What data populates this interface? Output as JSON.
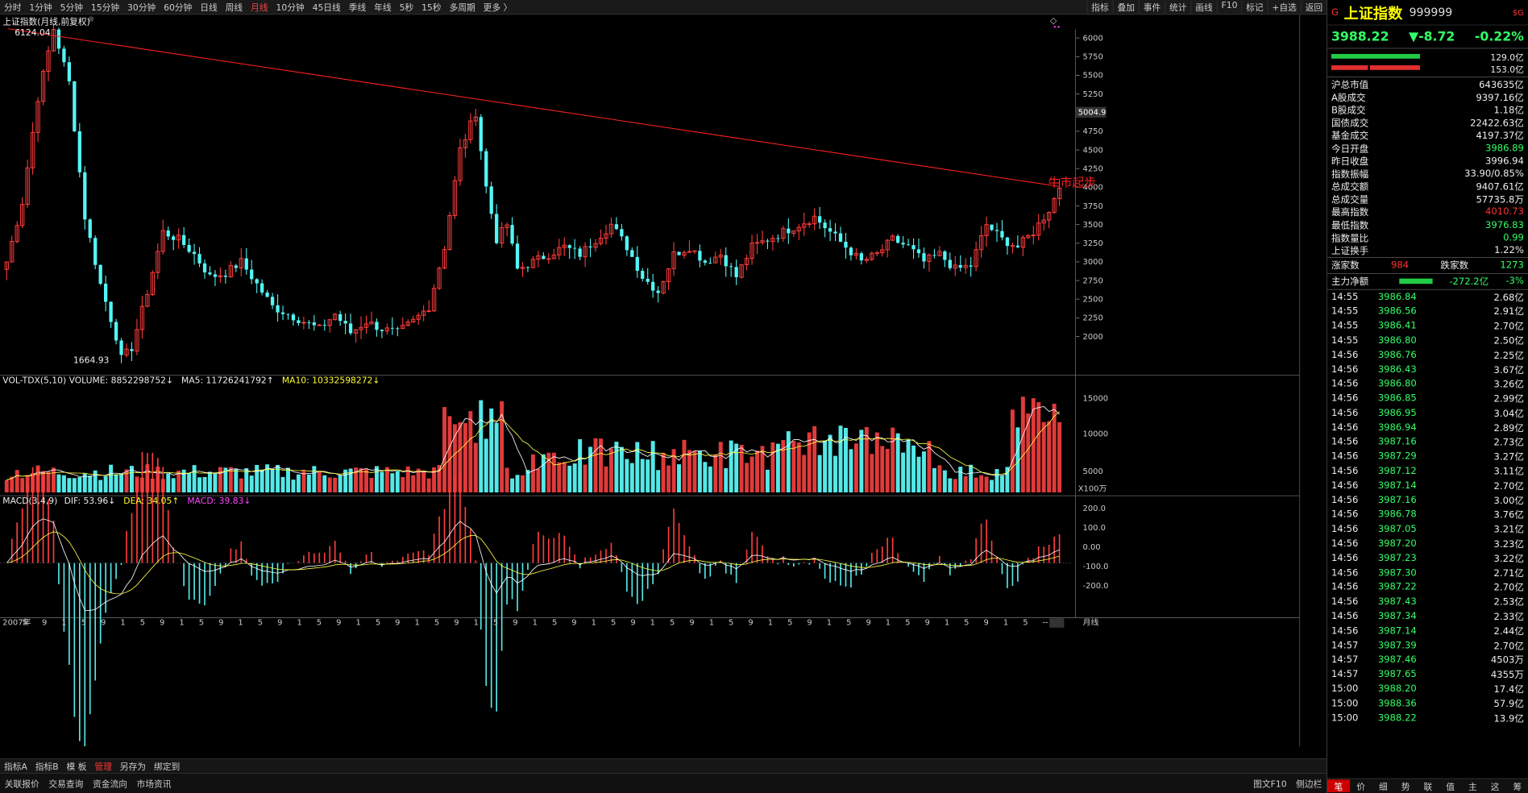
{
  "toolbar": {
    "items": [
      "分时",
      "1分钟",
      "5分钟",
      "15分钟",
      "30分钟",
      "60分钟",
      "日线",
      "周线",
      "月线",
      "10分钟",
      "45日线",
      "季线",
      "年线",
      "5秒",
      "15秒",
      "多周期",
      "更多 〉"
    ],
    "active": "月线",
    "right": [
      "指标",
      "叠加",
      "事件",
      "统计",
      "画线",
      "F10",
      "标记",
      "+自选",
      "返回"
    ]
  },
  "chart": {
    "title": "上证指数(月线,前复权)",
    "high_label": "6124.04",
    "low_label": "1664.93",
    "line_label": "牛市起步",
    "price_marker": "5004.9",
    "price_ticks": [
      "6000",
      "5750",
      "5500",
      "5250",
      "5000",
      "4750",
      "4500",
      "4250",
      "4000",
      "3750",
      "3500",
      "3250",
      "3000",
      "2750",
      "2500",
      "2250",
      "2000"
    ],
    "vol_label": "VOL-TDX(5,10) VOLUME: 8852298752↓",
    "vol_ma5": "MA5: 11726241792↑",
    "vol_ma10": "MA10: 10332598272↓",
    "vol_ticks": [
      "15000",
      "10000",
      "5000"
    ],
    "vol_unit": "X100万",
    "macd_label": "MACD(3,4,9)",
    "macd_dif": "DIF: 53.96↓",
    "macd_dea": "DEA: 34.05↑",
    "macd_val": "MACD: 39.83↓",
    "macd_ticks": [
      "200.0",
      "100.0",
      "0.00",
      "-100.0",
      "-200.0"
    ],
    "x_axis": [
      "2007年",
      "5",
      "9",
      "1",
      "5",
      "9",
      "1",
      "5",
      "9",
      "1",
      "5",
      "9",
      "1",
      "5",
      "9",
      "1",
      "5",
      "9",
      "1",
      "5",
      "9",
      "1",
      "5",
      "9",
      "1",
      "5",
      "9",
      "1",
      "5",
      "9",
      "1",
      "5",
      "9",
      "1",
      "5",
      "9",
      "1",
      "5",
      "9",
      "1",
      "5",
      "9",
      "1",
      "5",
      "9",
      "1",
      "5",
      "9",
      "1",
      "5",
      "9",
      "1",
      "5",
      "--"
    ],
    "period": "月线",
    "colors": {
      "up": "#ff3c3c",
      "down": "#54f5f5",
      "trend": "#ff2020"
    }
  },
  "tabs": {
    "items": [
      "指标A",
      "指标B",
      "模 板",
      "管理",
      "另存为",
      "绑定到"
    ],
    "selected": "管理"
  },
  "bottom": {
    "items": [
      "关联报价",
      "交易查询",
      "资金流向",
      "市场资讯"
    ],
    "right": [
      "图文F10",
      "侧边栏"
    ]
  },
  "side": {
    "flag": "G",
    "name": "上证指数",
    "code": "999999",
    "badge": "$G",
    "price": "3988.22",
    "change": "▼-8.72",
    "pct": "-0.22%",
    "bar1": "129.0亿",
    "bar2": "153.0亿",
    "stats": [
      [
        "沪总市值",
        "643635亿",
        "w"
      ],
      [
        "A股成交",
        "9397.16亿",
        "w"
      ],
      [
        "B股成交",
        "1.18亿",
        "w"
      ],
      [
        "国债成交",
        "22422.63亿",
        "w"
      ],
      [
        "基金成交",
        "4197.37亿",
        "w"
      ],
      [
        "今日开盘",
        "3986.89",
        "g"
      ],
      [
        "昨日收盘",
        "3996.94",
        "w"
      ],
      [
        "指数振幅",
        "33.90/0.85%",
        "w"
      ],
      [
        "总成交额",
        "9407.61亿",
        "w"
      ],
      [
        "总成交量",
        "57735.8万",
        "w"
      ],
      [
        "最高指数",
        "4010.73",
        "r"
      ],
      [
        "最低指数",
        "3976.83",
        "g"
      ],
      [
        "指数量比",
        "0.99",
        "g"
      ],
      [
        "上证换手",
        "1.22%",
        "w"
      ]
    ],
    "updown": {
      "up_label": "涨家数",
      "up": "984",
      "down_label": "跌家数",
      "down": "1273"
    },
    "flow": {
      "label": "主力净额",
      "value": "-272.2亿",
      "pct": "-3%"
    },
    "ticks": [
      [
        "14:55",
        "3986.84",
        "2.68亿"
      ],
      [
        "14:55",
        "3986.56",
        "2.91亿"
      ],
      [
        "14:55",
        "3986.41",
        "2.70亿"
      ],
      [
        "14:55",
        "3986.80",
        "2.50亿"
      ],
      [
        "14:56",
        "3986.76",
        "2.25亿"
      ],
      [
        "14:56",
        "3986.43",
        "3.67亿"
      ],
      [
        "14:56",
        "3986.80",
        "3.26亿"
      ],
      [
        "14:56",
        "3986.85",
        "2.99亿"
      ],
      [
        "14:56",
        "3986.95",
        "3.04亿"
      ],
      [
        "14:56",
        "3986.94",
        "2.89亿"
      ],
      [
        "14:56",
        "3987.16",
        "2.73亿"
      ],
      [
        "14:56",
        "3987.29",
        "3.27亿"
      ],
      [
        "14:56",
        "3987.12",
        "3.11亿"
      ],
      [
        "14:56",
        "3987.14",
        "2.70亿"
      ],
      [
        "14:56",
        "3987.16",
        "3.00亿"
      ],
      [
        "14:56",
        "3986.78",
        "3.76亿"
      ],
      [
        "14:56",
        "3987.05",
        "3.21亿"
      ],
      [
        "14:56",
        "3987.20",
        "3.23亿"
      ],
      [
        "14:56",
        "3987.23",
        "3.22亿"
      ],
      [
        "14:56",
        "3987.30",
        "2.71亿"
      ],
      [
        "14:56",
        "3987.22",
        "2.70亿"
      ],
      [
        "14:56",
        "3987.43",
        "2.53亿"
      ],
      [
        "14:56",
        "3987.34",
        "2.33亿"
      ],
      [
        "14:56",
        "3987.14",
        "2.44亿"
      ],
      [
        "14:57",
        "3987.39",
        "2.70亿"
      ],
      [
        "14:57",
        "3987.46",
        "4503万"
      ],
      [
        "14:57",
        "3987.65",
        "4355万"
      ],
      [
        "15:00",
        "3988.20",
        "17.4亿"
      ],
      [
        "15:00",
        "3988.36",
        "57.9亿"
      ],
      [
        "15:00",
        "3988.22",
        "13.9亿"
      ]
    ],
    "foot": [
      "笔",
      "价",
      "细",
      "势",
      "联",
      "值",
      "主",
      "这",
      "筹"
    ]
  }
}
